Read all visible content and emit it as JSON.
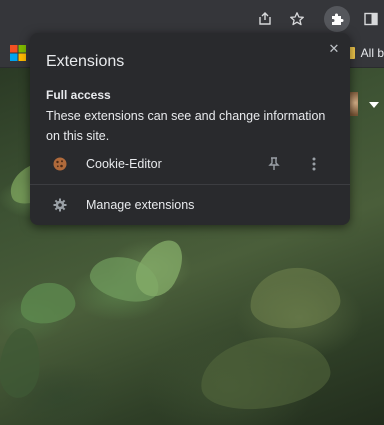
{
  "bookmarks_bar": {
    "all_bookmarks_label": "All b"
  },
  "popup": {
    "title": "Extensions",
    "close_glyph": "✕",
    "section": {
      "heading": "Full access",
      "description": "These extensions can see and change information on this site."
    },
    "extensions": [
      {
        "name": "Cookie-Editor",
        "icon": "cookie-icon",
        "pinned": false
      }
    ],
    "manage_label": "Manage extensions"
  },
  "icons": {
    "share": "share-icon",
    "bookmark_star": "star-icon",
    "extensions": "puzzle-icon",
    "sidebar": "sidebar-icon",
    "apps": "windows-logo-icon",
    "pin": "pin-icon",
    "more": "more-vert-icon",
    "manage": "gear-icon"
  },
  "colors": {
    "toolbar": "#35363a",
    "popup_bg": "#292a2d",
    "text": "#e8eaed",
    "muted_icon": "#9aa0a6"
  }
}
